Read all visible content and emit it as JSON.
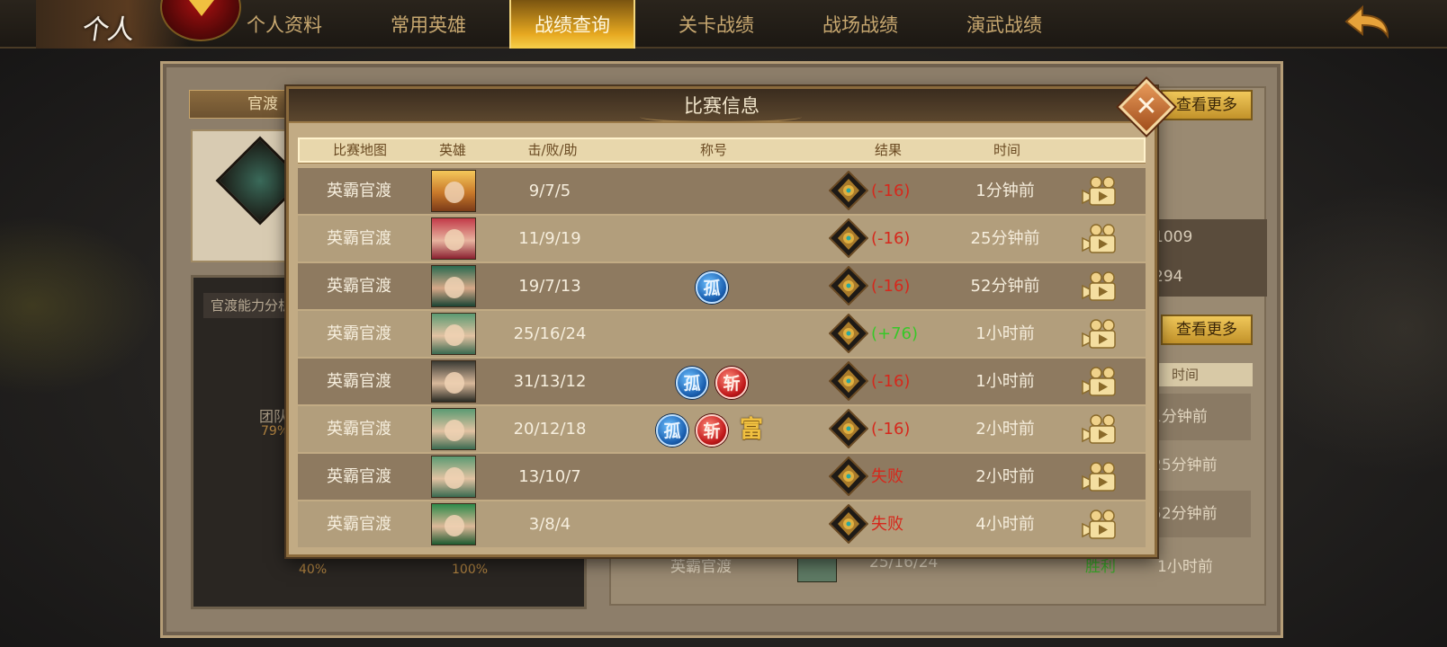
{
  "logo": {
    "text": "个人"
  },
  "nav": {
    "tabs": [
      {
        "label": "个人资料",
        "active": false
      },
      {
        "label": "常用英雄",
        "active": false
      },
      {
        "label": "战绩查询",
        "active": true
      },
      {
        "label": "关卡战绩",
        "active": false
      },
      {
        "label": "战场战绩",
        "active": false
      },
      {
        "label": "演武战绩",
        "active": false
      }
    ]
  },
  "background": {
    "left_tab_label": "官渡",
    "ability_title": "官渡能力分析",
    "ability_team": "团队",
    "ability_pct1": "79%",
    "ability_pct2": "40%",
    "ability_pct3": "100%",
    "more_button_1": "查看更多",
    "more_button_2": "查看更多",
    "stat_1": "1009",
    "stat_2": "294",
    "time_header": "时间",
    "time_rows": [
      "1分钟前",
      "25分钟前",
      "52分钟前",
      "1小时前"
    ],
    "bottom_row": {
      "map": "英霸官渡",
      "kda": "25/16/24",
      "result": "胜利",
      "time": "1小时前"
    }
  },
  "modal": {
    "title": "比赛信息",
    "close_icon": "close-x-icon",
    "headers": {
      "map": "比赛地图",
      "hero": "英雄",
      "kda": "击/败/助",
      "title": "称号",
      "result": "结果",
      "time": "时间"
    },
    "rows": [
      {
        "map": "英霸官渡",
        "hero": "bearded-warrior",
        "kda": "9/7/5",
        "badges": [],
        "result": "(-16)",
        "result_type": "loss",
        "time": "1分钟前"
      },
      {
        "map": "英霸官渡",
        "hero": "red-hood-heroine",
        "kda": "11/9/19",
        "badges": [],
        "result": "(-16)",
        "result_type": "loss",
        "time": "25分钟前"
      },
      {
        "map": "英霸官渡",
        "hero": "green-heroine",
        "kda": "19/7/13",
        "badges": [
          {
            "text": "孤",
            "color": "blue"
          }
        ],
        "result": "(-16)",
        "result_type": "loss",
        "time": "52分钟前"
      },
      {
        "map": "英霸官渡",
        "hero": "chubby-boy",
        "kda": "25/16/24",
        "badges": [],
        "result": "(+76)",
        "result_type": "win",
        "time": "1小时前"
      },
      {
        "map": "英霸官渡",
        "hero": "mustached-man",
        "kda": "31/13/12",
        "badges": [
          {
            "text": "孤",
            "color": "blue"
          },
          {
            "text": "斩",
            "color": "red"
          }
        ],
        "result": "(-16)",
        "result_type": "loss",
        "time": "1小时前"
      },
      {
        "map": "英霸官渡",
        "hero": "chubby-boy",
        "kda": "20/12/18",
        "badges": [
          {
            "text": "孤",
            "color": "blue"
          },
          {
            "text": "斩",
            "color": "red"
          },
          {
            "text": "富",
            "color": "gold"
          }
        ],
        "result": "(-16)",
        "result_type": "loss",
        "time": "2小时前"
      },
      {
        "map": "英霸官渡",
        "hero": "chubby-boy",
        "kda": "13/10/7",
        "badges": [],
        "result": "失败",
        "result_type": "loss",
        "time": "2小时前"
      },
      {
        "map": "英霸官渡",
        "hero": "green-robed-man",
        "kda": "3/8/4",
        "badges": [],
        "result": "失败",
        "result_type": "loss",
        "time": "4小时前"
      }
    ]
  },
  "colors": {
    "loss": "#d6281c",
    "win": "#38c828",
    "gold_accent": "#e6a820",
    "panel": "#c2ab84"
  }
}
